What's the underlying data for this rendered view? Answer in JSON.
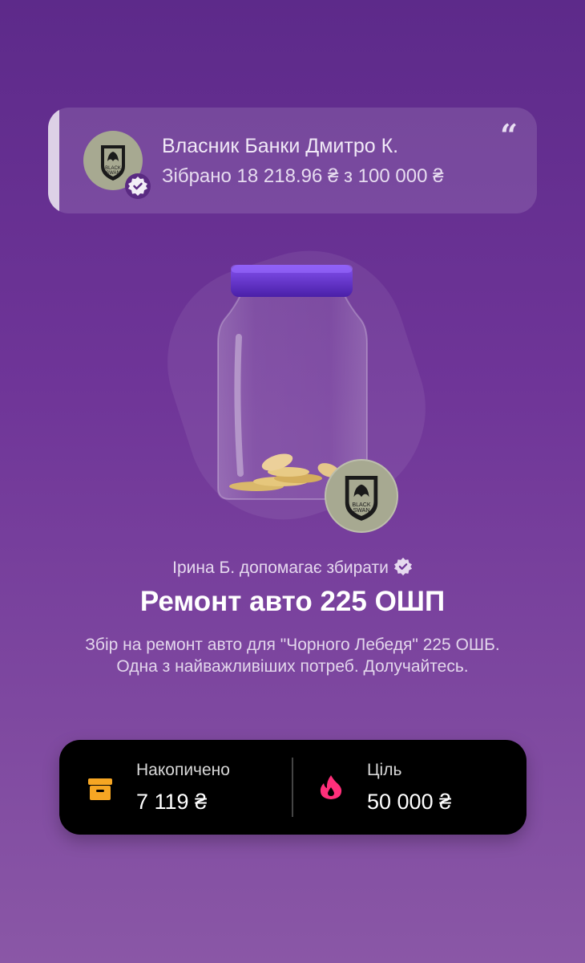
{
  "owner": {
    "name": "Власник Банки Дмитро К.",
    "collected_text": "Зібрано 18 218.96 ₴ з 100 000 ₴",
    "quote_symbol": "“"
  },
  "jar": {
    "helper_text": "Ірина Б. допомагає збирати",
    "title": "Ремонт авто 225 ОШП",
    "description": "Збір на ремонт авто для \"Чорного Лебедя\" 225 ОШБ. Одна з найважливіших потреб. Долучайтесь."
  },
  "stats": {
    "accumulated_label": "Накопичено",
    "accumulated_value": "7 119 ₴",
    "goal_label": "Ціль",
    "goal_value": "50 000 ₴"
  },
  "logo_text": "BLACK SWAN",
  "colors": {
    "background_top": "#5d2a8a",
    "background_bottom": "#8a57a6",
    "lid": "#6a2fd0",
    "accumulated_icon": "#f6a623",
    "goal_icon": "#ff2f7a",
    "card_dark": "#000000"
  },
  "icons": {
    "quote": "quote-icon",
    "verified": "verified-badge-icon",
    "accumulated": "archive-box-icon",
    "goal": "flame-icon"
  }
}
